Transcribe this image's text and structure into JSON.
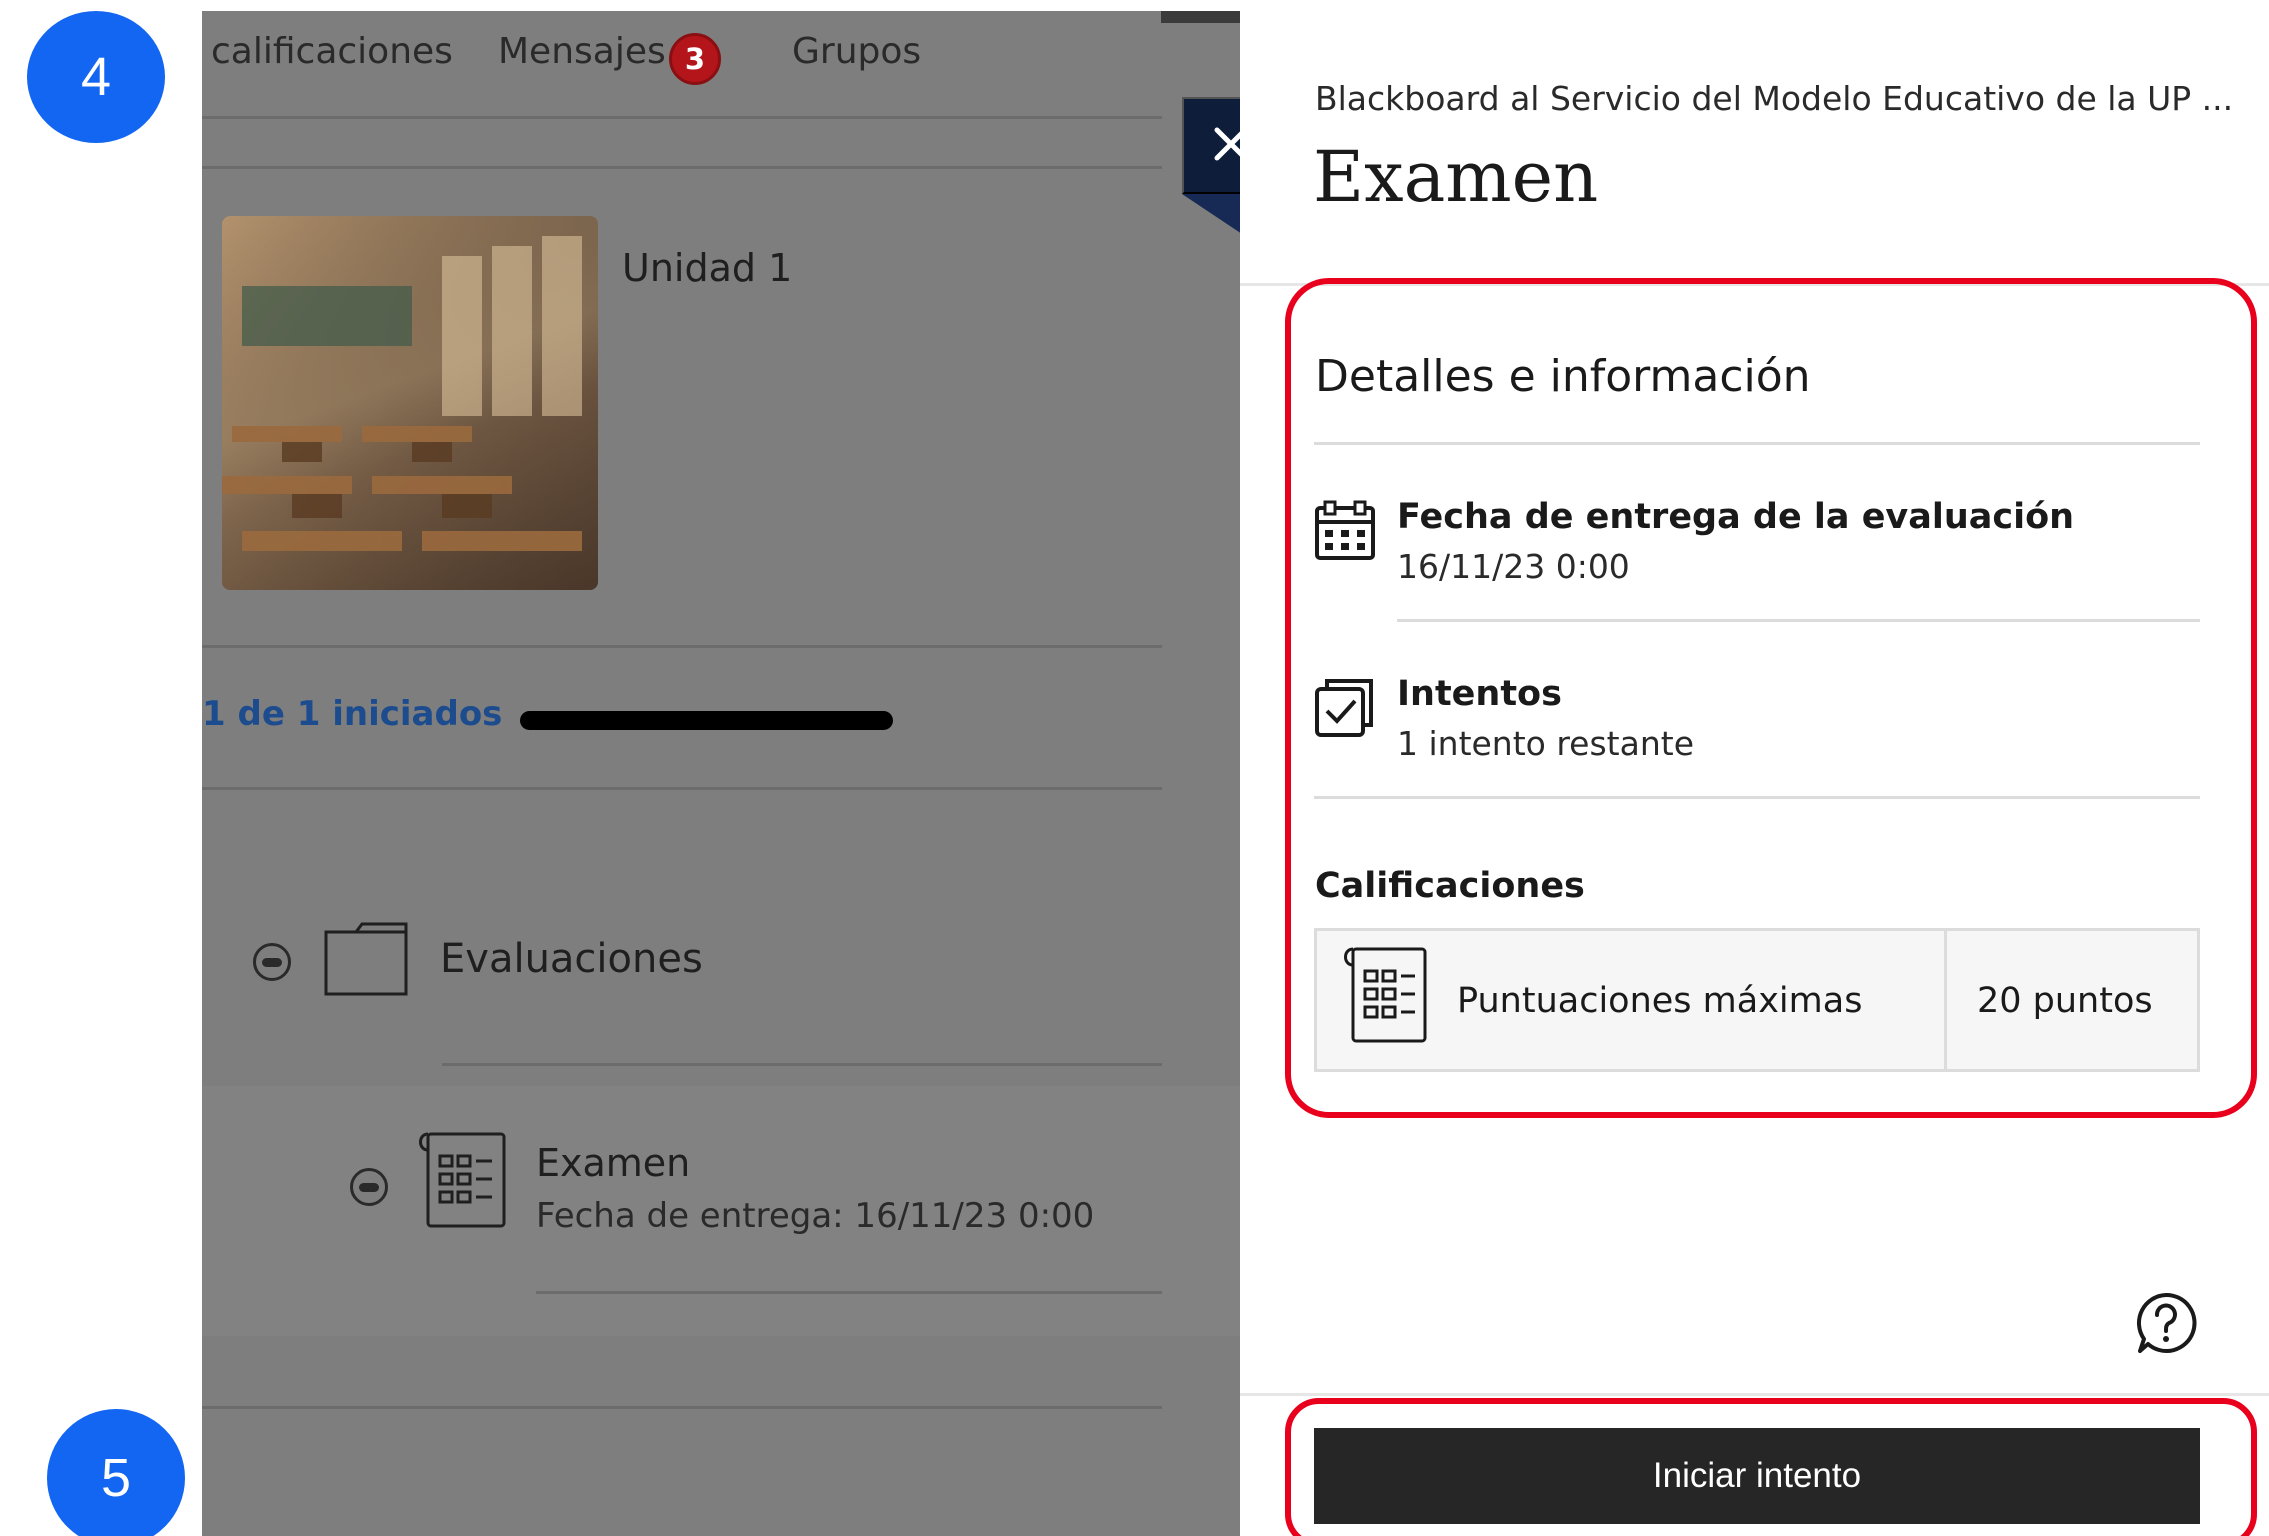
{
  "steps": {
    "top": "4",
    "bottom": "5"
  },
  "course_nav": {
    "grades": "calificaciones",
    "messages": "Mensajes",
    "messages_badge": "3",
    "groups": "Grupos"
  },
  "unit": {
    "title": "Unidad 1",
    "progress_text": "1 de 1 iniciados",
    "progress_fraction": 1.0
  },
  "content_items": {
    "folder_label": "Evaluaciones",
    "exam_title": "Examen",
    "exam_due": "Fecha de entrega: 16/11/23 0:00"
  },
  "panel": {
    "breadcrumb": "Blackboard al Servicio del Modelo Educativo de la UP ...",
    "title": "Examen",
    "details_heading": "Detalles e información",
    "due_label": "Fecha de entrega de la evaluación",
    "due_value": "16/11/23 0:00",
    "attempts_label": "Intentos",
    "attempts_value": "1 intento restante",
    "grades_heading": "Calificaciones",
    "max_score_label": "Puntuaciones máximas",
    "max_score_value": "20 puntos",
    "start_button": "Iniciar intento"
  },
  "icons": {
    "close": "close-icon",
    "calendar": "calendar-icon",
    "attempts": "attempts-icon",
    "gradebook": "gradebook-icon",
    "help": "help-icon",
    "folder": "folder-icon"
  },
  "colors": {
    "step_circle": "#1266f1",
    "highlight": "#e8001c",
    "badge": "#b3151b",
    "primary_button": "#262626",
    "close_button": "#0e1d3a",
    "progress_link": "#1d4c8e"
  }
}
